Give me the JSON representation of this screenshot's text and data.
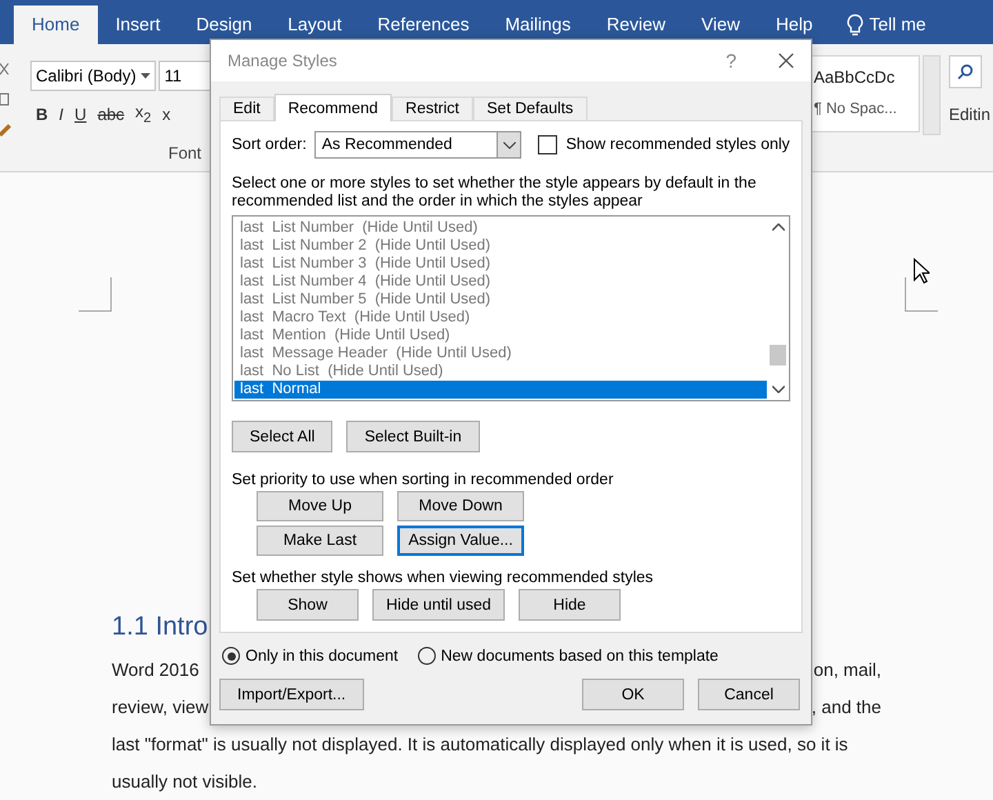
{
  "ribbon": {
    "tabs": [
      {
        "label": "Home",
        "selected": true
      },
      {
        "label": "Insert",
        "selected": false
      },
      {
        "label": "Design",
        "selected": false
      },
      {
        "label": "Layout",
        "selected": false
      },
      {
        "label": "References",
        "selected": false
      },
      {
        "label": "Mailings",
        "selected": false
      },
      {
        "label": "Review",
        "selected": false
      },
      {
        "label": "View",
        "selected": false
      },
      {
        "label": "Help",
        "selected": false
      },
      {
        "label": "Tell me",
        "selected": false,
        "kind": "tell"
      }
    ],
    "font_name": "Calibri (Body)",
    "font_size": "11",
    "format_buttons": [
      "B",
      "I",
      "U",
      "abc",
      "x$_{2}$",
      "x"
    ],
    "font_group_label": "Font",
    "style_preview": "AaBbCcDc",
    "style_name": "¶ No Spac...",
    "editing_label": "Editin"
  },
  "document": {
    "heading": "1.1 Intro",
    "lines": [
      {
        "left": "Word 2016",
        "right": "on, mail,"
      },
      {
        "left": "review, view",
        "right": ", and the"
      },
      {
        "left": "last \"format\" is usually not displayed. It is automatically displayed only when it is used, so it is"
      },
      {
        "left": "usually not visible."
      }
    ]
  },
  "dialog": {
    "title": "Manage Styles",
    "help": "?",
    "tabs": [
      {
        "label": "Edit",
        "selected": false
      },
      {
        "label": "Recommend",
        "selected": true
      },
      {
        "label": "Restrict",
        "selected": false
      },
      {
        "label": "Set Defaults",
        "selected": false
      }
    ],
    "sort_label": "Sort order:",
    "sort_value": "As Recommended",
    "show_recommended": {
      "label": "Show recommended styles only",
      "checked": false
    },
    "instructions": "Select one or more styles to set whether the style appears by default in the recommended list and the order in which the styles appear",
    "styles": [
      {
        "text": "last  List Number  (Hide Until Used)",
        "selected": false
      },
      {
        "text": "last  List Number 2  (Hide Until Used)",
        "selected": false
      },
      {
        "text": "last  List Number 3  (Hide Until Used)",
        "selected": false
      },
      {
        "text": "last  List Number 4  (Hide Until Used)",
        "selected": false
      },
      {
        "text": "last  List Number 5  (Hide Until Used)",
        "selected": false
      },
      {
        "text": "last  Macro Text  (Hide Until Used)",
        "selected": false
      },
      {
        "text": "last  Mention  (Hide Until Used)",
        "selected": false
      },
      {
        "text": "last  Message Header  (Hide Until Used)",
        "selected": false
      },
      {
        "text": "last  No List  (Hide Until Used)",
        "selected": false
      },
      {
        "text": "last  Normal",
        "selected": true
      }
    ],
    "select_buttons": [
      {
        "label": "Select All",
        "focused": false
      },
      {
        "label": "Select Built-in",
        "focused": false
      }
    ],
    "priority_label": "Set priority to use when sorting in recommended order",
    "priority_buttons": [
      {
        "label": "Move Up",
        "focused": false
      },
      {
        "label": "Move Down",
        "focused": false
      },
      {
        "label": "Make Last",
        "focused": false
      },
      {
        "label": "Assign Value...",
        "focused": true
      }
    ],
    "visibility_label": "Set whether style shows when viewing recommended styles",
    "visibility_buttons": [
      {
        "label": "Show",
        "focused": false
      },
      {
        "label": "Hide until used",
        "focused": false
      },
      {
        "label": "Hide",
        "focused": false
      }
    ],
    "scope": [
      {
        "label": "Only in this document",
        "selected": true
      },
      {
        "label": "New documents based on this template",
        "selected": false
      }
    ],
    "import_button": "Import/Export...",
    "ok_button": "OK",
    "cancel_button": "Cancel"
  }
}
